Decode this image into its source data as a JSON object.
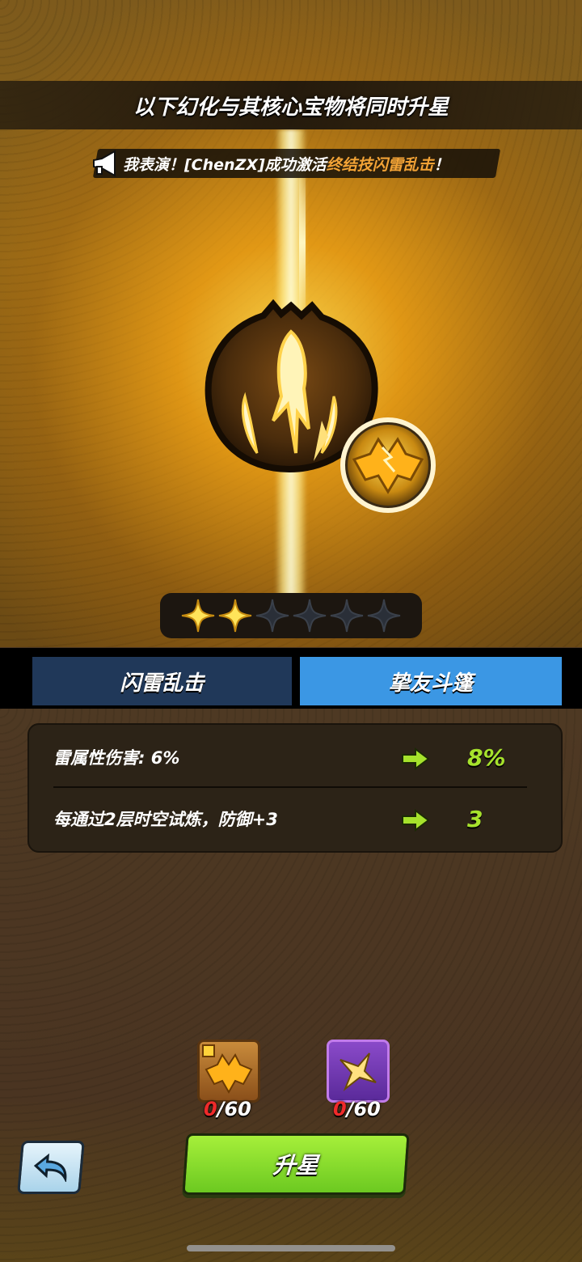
{
  "header": {
    "title": "以下幻化与其核心宝物将同时升星"
  },
  "announcement": {
    "prefix": "我表演！[ChenZX]成功激活",
    "highlight": "终结技闪雷乱击",
    "suffix": "！",
    "icon": "megaphone-icon"
  },
  "stars": {
    "filled": 2,
    "total": 6
  },
  "tabs": [
    {
      "label": "闪雷乱击",
      "active": false
    },
    {
      "label": "挚友斗篷",
      "active": true
    }
  ],
  "stats": [
    {
      "label": "雷属性伤害: 6%",
      "value": "8%"
    },
    {
      "label": "每通过2层时空试炼，防御+3",
      "value": "3"
    }
  ],
  "materials": [
    {
      "icon": "bat-cloak-fragment-icon",
      "have": "0",
      "need": "/60"
    },
    {
      "icon": "gold-star-icon",
      "have": "0",
      "need": "/60"
    }
  ],
  "buttons": {
    "back": "back-arrow-icon",
    "upgrade": "升星"
  },
  "colors": {
    "active_tab": "#3b97e4",
    "inactive_tab": "#203859",
    "upgrade_green": "#8ddc2e",
    "stat_value": "#a6e22c",
    "highlight_orange": "#f3a336",
    "count_red": "#ef2a2a"
  }
}
